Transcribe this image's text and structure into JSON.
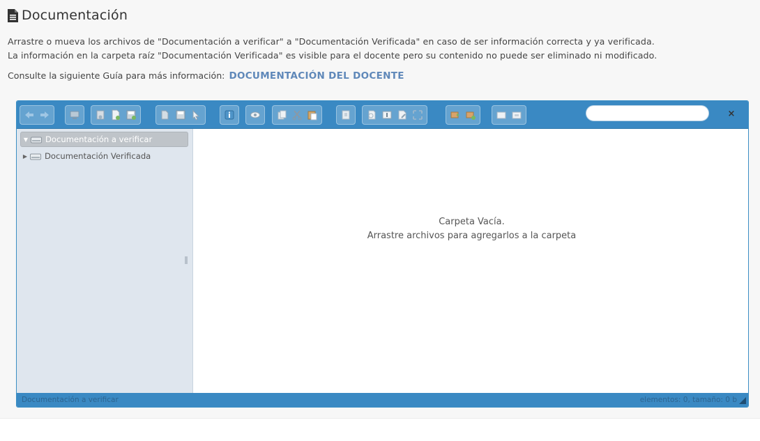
{
  "page": {
    "title": "Documentación",
    "description_line1": "Arrastre o mueva los archivos de \"Documentación a verificar\" a \"Documentación Verificada\" en caso de ser información correcta y ya verificada.",
    "description_line2": "La información en la carpeta raíz \"Documentación Verificada\" es visible para el docente pero su contenido no puede ser eliminado ni modificado.",
    "guide_text": "Consulte la siguiente Guía para más información:",
    "guide_link": "DOCUMENTACIÓN DEL DOCENTE"
  },
  "file_manager": {
    "toolbar": {
      "icons": [
        "back-icon",
        "forward-icon",
        "home-icon",
        "reload-icon",
        "new-file-icon",
        "save-icon",
        "open-icon",
        "save-as-icon",
        "select-icon",
        "info-icon",
        "preview-icon",
        "copy-icon",
        "cut-icon",
        "paste-icon",
        "archive-icon",
        "duplicate-icon",
        "rename-icon",
        "edit-icon",
        "resize-icon",
        "extract-icon",
        "compress-icon",
        "view-icon",
        "list-icon"
      ],
      "search": {
        "value": "",
        "placeholder": ""
      },
      "close_label": "×"
    },
    "tree": {
      "items": [
        {
          "label": "Documentación a verificar",
          "active": true,
          "expanded": true
        },
        {
          "label": "Documentación Verificada",
          "active": false,
          "expanded": false
        }
      ]
    },
    "content": {
      "empty_line1": "Carpeta Vacía.",
      "empty_line2": "Arrastre archivos para agregarlos a la carpeta"
    },
    "statusbar": {
      "path": "Documentación a verificar",
      "info": "elementos: 0, tamaño: 0 b"
    },
    "colors": {
      "toolbar": "#3a89c3",
      "tree_bg": "#dfe6ee",
      "link": "#5f88b9"
    }
  }
}
